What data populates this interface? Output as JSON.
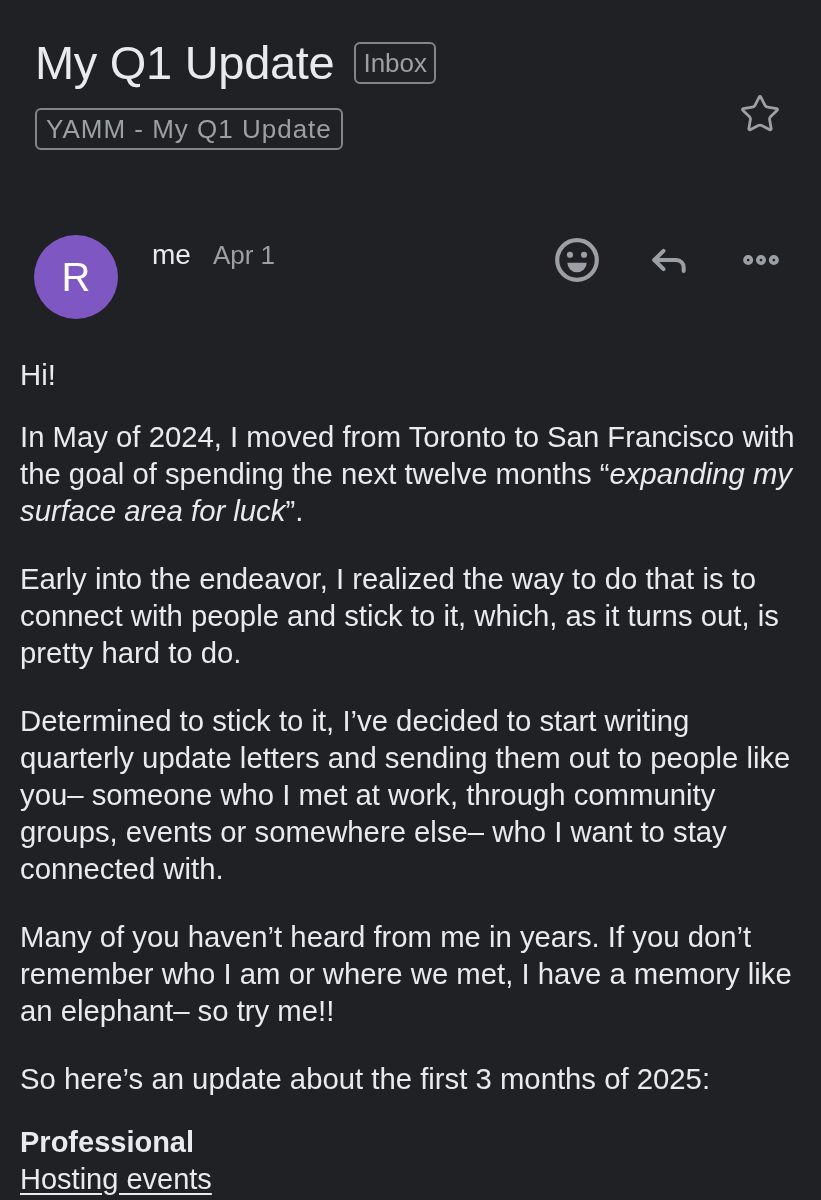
{
  "header": {
    "title": "My Q1 Update",
    "folder_badge": "Inbox",
    "label_chip": "YAMM - My Q1 Update",
    "starred": false
  },
  "message": {
    "avatar_initial": "R",
    "sender": "me",
    "date": "Apr 1"
  },
  "body": [
    {
      "kind": "paragraph",
      "text": "Hi!"
    },
    {
      "kind": "paragraph",
      "text": "In May of 2024, I moved from Toronto to San Francisco with the goal of spending the next twelve months “*expanding my surface area for luck*”."
    },
    {
      "kind": "paragraph",
      "text": "Early into the endeavor, I realized the way to do that is to connect with people and stick to it, which, as it turns out, is pretty hard to do."
    },
    {
      "kind": "paragraph",
      "text": "Determined to stick to it, I’ve decided to start writing quarterly update letters and sending them out to people like you– someone who I met at work, through community groups, events or somewhere else– who I want to stay connected with."
    },
    {
      "kind": "paragraph",
      "text": "Many of you haven’t heard from me in years. If you don’t remember who I am or where we met, I have a memory like an elephant– so try me!!"
    },
    {
      "kind": "paragraph",
      "text": "So here’s an update about the first 3 months of 2025:"
    },
    {
      "kind": "heading",
      "text": "Professional"
    },
    {
      "kind": "link",
      "text": "Hosting events"
    }
  ]
}
